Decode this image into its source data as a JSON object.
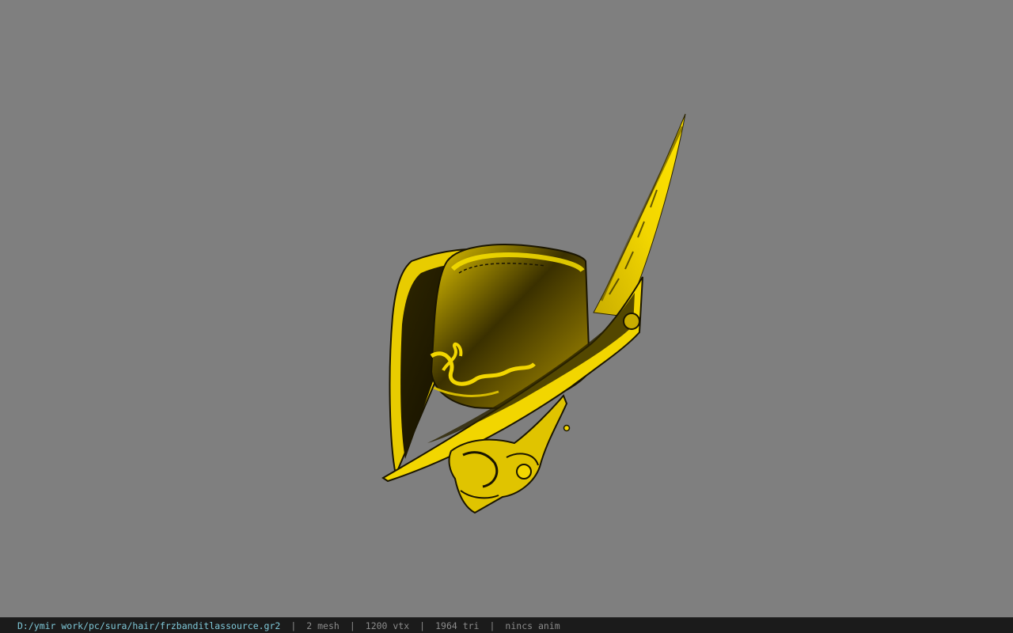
{
  "viewer": {
    "background_color": "#7f7f7f",
    "model_color": "#f2d600",
    "model_subject": "hat-with-feather"
  },
  "status": {
    "file_path": "D:/ymir work/pc/sura/hair/frzbanditlassource.gr2",
    "separator": "|",
    "mesh_count": "2 mesh",
    "vertex_count": "1200 vtx",
    "triangle_count": "1964 tri",
    "anim_info": "nincs anim"
  }
}
